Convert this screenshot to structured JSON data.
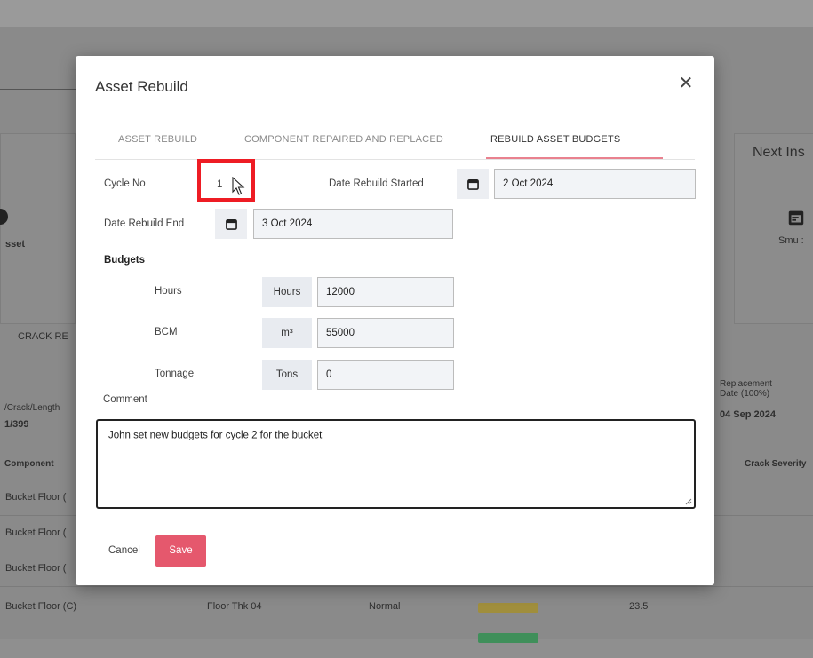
{
  "modal": {
    "title": "Asset Rebuild",
    "close_icon": "close-icon"
  },
  "tabs": [
    {
      "label": "ASSET REBUILD",
      "active": false
    },
    {
      "label": "COMPONENT REPAIRED AND REPLACED",
      "active": false
    },
    {
      "label": "REBUILD ASSET BUDGETS",
      "active": true
    }
  ],
  "form": {
    "cycle_no_label": "Cycle No",
    "cycle_no_value": "1",
    "date_started_label": "Date Rebuild Started",
    "date_started_value": "2 Oct 2024",
    "date_end_label": "Date Rebuild End",
    "date_end_value": "3 Oct 2024",
    "calendar_icon": "calendar-icon"
  },
  "budgets": {
    "heading": "Budgets",
    "hours_label": "Hours",
    "hours_unit": "Hours",
    "hours_value": "12000",
    "bcm_label": "BCM",
    "bcm_unit": "m³",
    "bcm_value": "55000",
    "tonnage_label": "Tonnage",
    "tonnage_unit": "Tons",
    "tonnage_value": "0"
  },
  "comment": {
    "label": "Comment",
    "value": "John set new budgets for cycle 2 for the bucket"
  },
  "actions": {
    "cancel_label": "Cancel",
    "save_label": "Save",
    "save_color": "#e5586d"
  },
  "background": {
    "next_insp": "Next Ins",
    "asset_fragment": "sset",
    "smu_fragment": "Smu :",
    "crack_tab": "CRACK RE",
    "crack_length_header": "/Crack/Length",
    "crack_length_value": "1/399",
    "replacement_date_label": "Replacement Date (100%)",
    "replacement_date_value": "04 Sep 2024",
    "component_header": "Component",
    "crack_severity_header": "Crack Severity",
    "rows": [
      {
        "component": "Bucket Floor (",
        "name": "",
        "status": "",
        "value": ""
      },
      {
        "component": "Bucket Floor (",
        "name": "",
        "status": "",
        "value": ""
      },
      {
        "component": "Bucket Floor (",
        "name": "",
        "status": "",
        "value": ""
      },
      {
        "component": "Bucket Floor (C)",
        "name": "Floor Thk 04",
        "status": "Normal",
        "value": "23.5"
      }
    ]
  }
}
